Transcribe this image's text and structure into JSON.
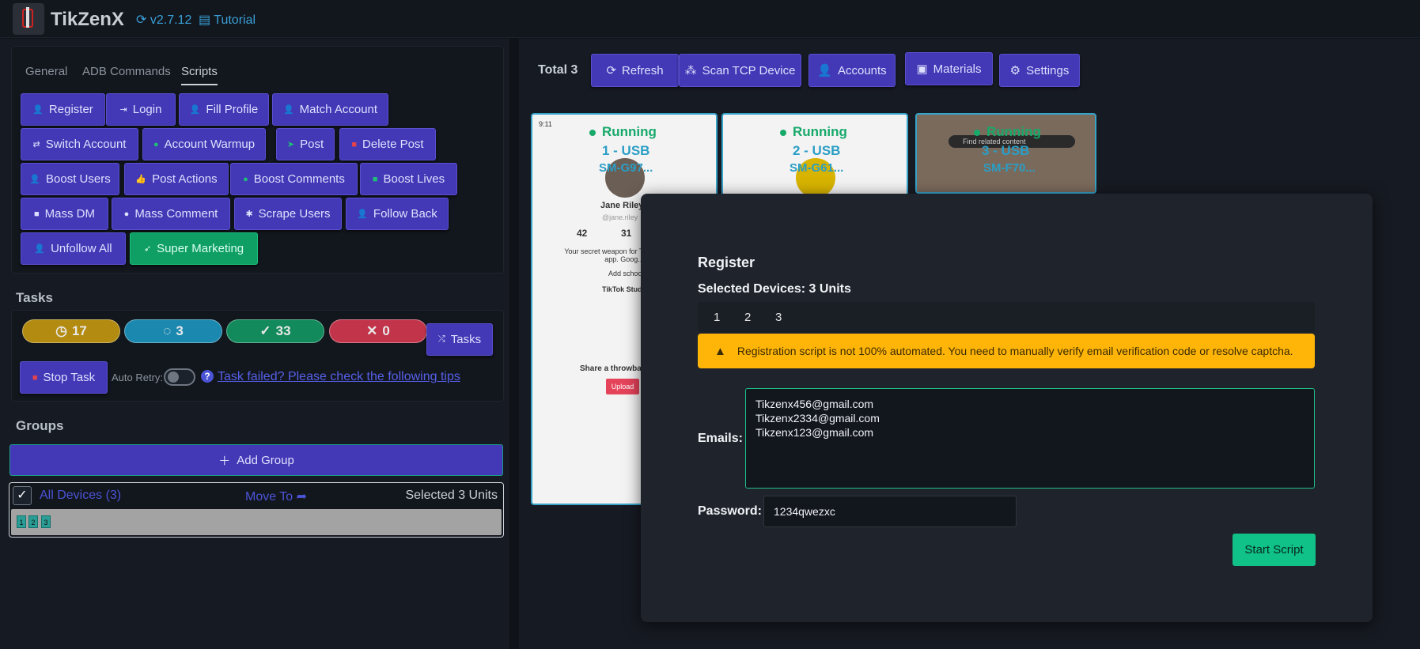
{
  "app": {
    "title": "TikZenX",
    "version": "v2.7.12",
    "tutorial": "Tutorial"
  },
  "left_tabs": [
    "General",
    "ADB Commands",
    "Scripts"
  ],
  "scripts": {
    "row1": [
      "Register",
      "Login",
      "Fill Profile",
      "Match Account"
    ],
    "row2": [
      "Switch Account",
      "Account Warmup",
      "Post",
      "Delete Post"
    ],
    "row3": [
      "Boost Users",
      "Post Actions",
      "Boost Comments",
      "Boost Lives"
    ],
    "row4": [
      "Mass DM",
      "Mass Comment",
      "Scrape Users",
      "Follow Back"
    ],
    "row5": [
      "Unfollow All",
      "Super Marketing"
    ]
  },
  "tasks": {
    "heading": "Tasks",
    "counts": {
      "pending": "17",
      "running": "3",
      "success": "33",
      "failed": "0"
    },
    "tasks_button": "Tasks",
    "stop_button": "Stop Task",
    "auto_retry": "Auto Retry:",
    "help_link": "Task failed? Please check the following tips"
  },
  "groups": {
    "heading": "Groups",
    "add_group": "Add Group",
    "all_devices": "All Devices (3)",
    "move_to": "Move To",
    "selected": "Selected 3 Units",
    "device_chips": [
      "1",
      "2",
      "3"
    ]
  },
  "toolbar": {
    "total": "Total 3",
    "refresh": "Refresh",
    "scan": "Scan TCP Device",
    "accounts": "Accounts",
    "materials": "Materials",
    "settings": "Settings"
  },
  "devices": [
    {
      "status": "Running",
      "conn": "1 - USB",
      "model": "SM-G97...",
      "name": "Jane Riley",
      "handle": "@jane.riley"
    },
    {
      "status": "Running",
      "conn": "2 - USB",
      "model": "SM-G61..."
    },
    {
      "status": "Running",
      "conn": "3 - USB",
      "model": "SM-F70...",
      "search": "Find related content"
    }
  ],
  "phone1": {
    "time": "9:11",
    "following": "42",
    "followers": "31",
    "bio": "Your secret weapon for TikT... Android app. Goog...",
    "add_school": "Add school",
    "studio": "TikTok Stud...",
    "share": "Share a throwbac...",
    "upload": "Upload"
  },
  "modal": {
    "title": "Register",
    "selected": "Selected Devices: 3 Units",
    "devices": [
      "1",
      "2",
      "3"
    ],
    "warning": "Registration script is not 100% automated. You need to manually verify email verification code or resolve captcha.",
    "emails_label": "Emails:",
    "emails_value": "Tikzenx456@gmail.com\nTikzenx2334@gmail.com\nTikzenx123@gmail.com",
    "password_label": "Password:",
    "password_value": "1234qwezxc",
    "start": "Start Script"
  },
  "colors": {
    "accent": "#4338b5",
    "success": "#10c188",
    "warning": "#ffb508",
    "running": "#17a96a"
  }
}
